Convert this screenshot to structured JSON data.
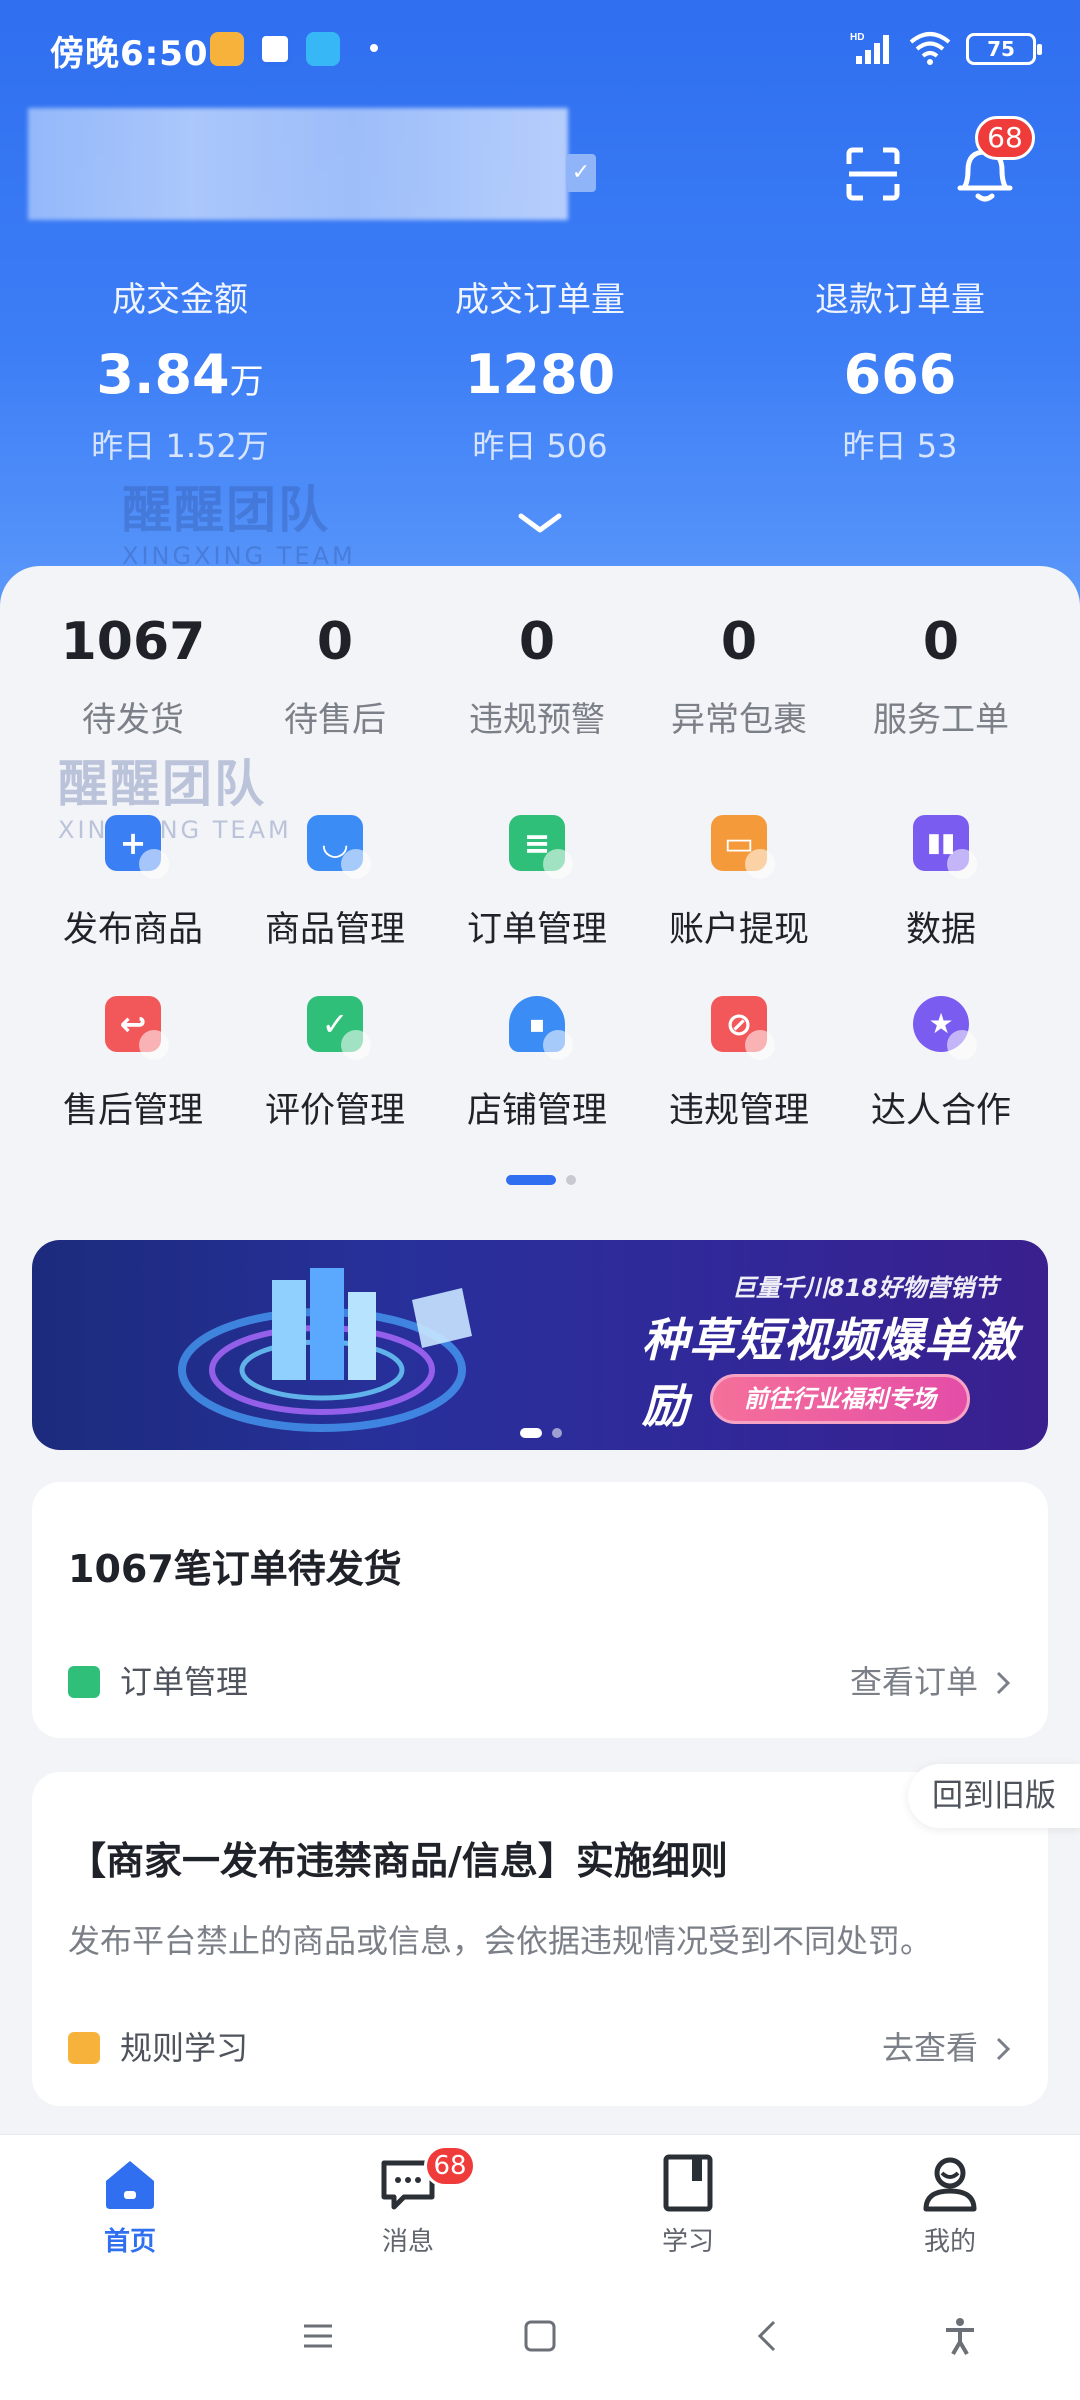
{
  "status_bar": {
    "time": "傍晚6:50",
    "battery": "75",
    "network_label": "HD",
    "icons": [
      "app-notification-icon",
      "app-notification-icon",
      "app-notification-icon",
      "signal-icon",
      "wifi-icon",
      "battery-icon"
    ]
  },
  "header": {
    "badge_count": "68",
    "icons": [
      "scan-icon",
      "bell-icon"
    ]
  },
  "stats": [
    {
      "label": "成交金额",
      "value": "3.84",
      "unit": "万",
      "yesterday": "昨日 1.52万"
    },
    {
      "label": "成交订单量",
      "value": "1280",
      "unit": "",
      "yesterday": "昨日 506"
    },
    {
      "label": "退款订单量",
      "value": "666",
      "unit": "",
      "yesterday": "昨日 53"
    }
  ],
  "watermark": {
    "title": "醒醒团队",
    "subtitle": "XINGXING TEAM"
  },
  "todo": [
    {
      "value": "1067",
      "label": "待发货"
    },
    {
      "value": "0",
      "label": "待售后"
    },
    {
      "value": "0",
      "label": "违规预警"
    },
    {
      "value": "0",
      "label": "异常包裹"
    },
    {
      "value": "0",
      "label": "服务工单"
    }
  ],
  "shortcuts": [
    {
      "label": "发布商品",
      "icon": "add-product-icon",
      "color": "#3b7ff5"
    },
    {
      "label": "商品管理",
      "icon": "shopping-bag-icon",
      "color": "#3b8cf5"
    },
    {
      "label": "订单管理",
      "icon": "order-list-icon",
      "color": "#2fbf78"
    },
    {
      "label": "账户提现",
      "icon": "wallet-icon",
      "color": "#f59a3b"
    },
    {
      "label": "数据",
      "icon": "bar-chart-icon",
      "color": "#7b5cf0"
    },
    {
      "label": "售后管理",
      "icon": "return-icon",
      "color": "#f2585a"
    },
    {
      "label": "评价管理",
      "icon": "check-icon",
      "color": "#2fbf78"
    },
    {
      "label": "店铺管理",
      "icon": "store-icon",
      "color": "#3b8cf5"
    },
    {
      "label": "违规管理",
      "icon": "prohibited-icon",
      "color": "#f2585a"
    },
    {
      "label": "达人合作",
      "icon": "star-badge-icon",
      "color": "#7b5cf0"
    }
  ],
  "banner": {
    "small_title": "巨量千川818好物营销节",
    "title": "种草短视频爆单激励",
    "button": "前往行业福利专场"
  },
  "order_card": {
    "title": "1067笔订单待发货",
    "tag": "订单管理",
    "link": "查看订单"
  },
  "rule_card": {
    "title": "【商家一发布违禁商品/信息】实施细则",
    "desc": "发布平台禁止的商品或信息，会依据违规情况受到不同处罚。",
    "tag": "规则学习",
    "link": "去查看"
  },
  "old_version": "回到旧版",
  "tabs": [
    {
      "label": "首页",
      "icon": "home-icon",
      "active": true
    },
    {
      "label": "消息",
      "icon": "message-icon",
      "badge": "68"
    },
    {
      "label": "学习",
      "icon": "book-icon"
    },
    {
      "label": "我的",
      "icon": "profile-icon"
    }
  ],
  "colors": {
    "brand_blue": "#2f6ff0",
    "badge_red": "#f03b3b"
  }
}
